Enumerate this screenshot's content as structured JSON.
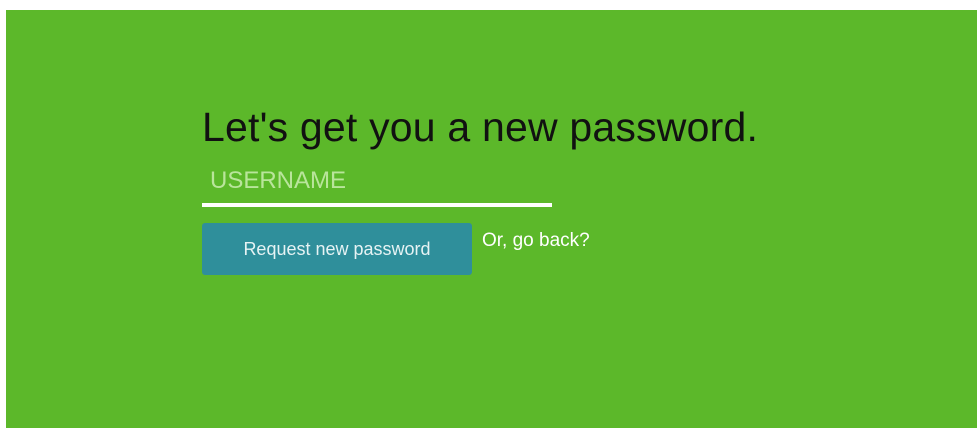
{
  "form": {
    "title": "Let's get you a new password.",
    "username_placeholder": "USERNAME",
    "username_value": "",
    "request_button_label": "Request new password",
    "back_link_label": "Or, go back?"
  },
  "colors": {
    "background": "#5cb82a",
    "button": "#2f8f9b",
    "field_underline": "#ffffff"
  }
}
